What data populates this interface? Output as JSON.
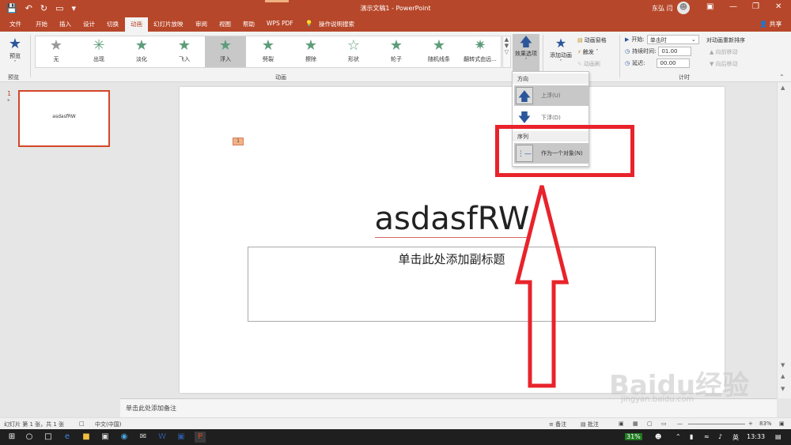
{
  "window": {
    "title": "演示文稿1 - PowerPoint",
    "user": "东弘 闫",
    "share": "共享"
  },
  "tabs": [
    "文件",
    "开始",
    "插入",
    "设计",
    "切换",
    "动画",
    "幻灯片放映",
    "审阅",
    "视图",
    "帮助",
    "WPS PDF"
  ],
  "active_tab": "动画",
  "tell_me": "操作说明搜索",
  "ribbon": {
    "preview": {
      "label": "预览",
      "group": "预览"
    },
    "animation_group": "动画",
    "gallery": [
      {
        "label": "无"
      },
      {
        "label": "出现"
      },
      {
        "label": "淡化"
      },
      {
        "label": "飞入"
      },
      {
        "label": "浮入"
      },
      {
        "label": "劈裂"
      },
      {
        "label": "擦除"
      },
      {
        "label": "形状"
      },
      {
        "label": "轮子"
      },
      {
        "label": "随机线条"
      },
      {
        "label": "翻转式由远..."
      }
    ],
    "selected_effect": "浮入",
    "effect_options": "效果选项",
    "add_animation": "添加动画",
    "animation_pane": "动画窗格",
    "trigger": "触发",
    "animation_painter": "动画刷",
    "timing": {
      "group": "计时",
      "start_label": "开始:",
      "start_value": "单击时",
      "duration_label": "持续时间:",
      "duration_value": "01.00",
      "delay_label": "延迟:",
      "delay_value": "00.00",
      "reorder_title": "对动画重新排序",
      "move_earlier": "向前移动",
      "move_later": "向后移动"
    }
  },
  "dropdown": {
    "direction_header": "方向",
    "float_up": "上浮(U)",
    "float_down": "下浮(D)",
    "sequence_header": "序列",
    "as_one_object": "作为一个对象(N)"
  },
  "thumbnails": [
    {
      "number": "1",
      "star": "*",
      "text": "asdasfRW"
    }
  ],
  "slide": {
    "anim_tag": "1",
    "title": "asdasfRW",
    "subtitle_placeholder": "单击此处添加副标题"
  },
  "notes_placeholder": "单击此处添加备注",
  "statusbar": {
    "slide_info": "幻灯片 第 1 张，共 1 张",
    "language": "中文(中国)",
    "notes": "备注",
    "comments": "批注",
    "zoom": "83%"
  },
  "taskbar": {
    "battery": "31%",
    "ime": "英",
    "time": "13:33"
  },
  "watermark": {
    "brand": "Baidu经验",
    "url": "jingyan.baidu.com"
  },
  "colors": {
    "accent": "#b7472a",
    "annotation_red": "#e8232b",
    "selected_gray": "#c8c8c8"
  }
}
